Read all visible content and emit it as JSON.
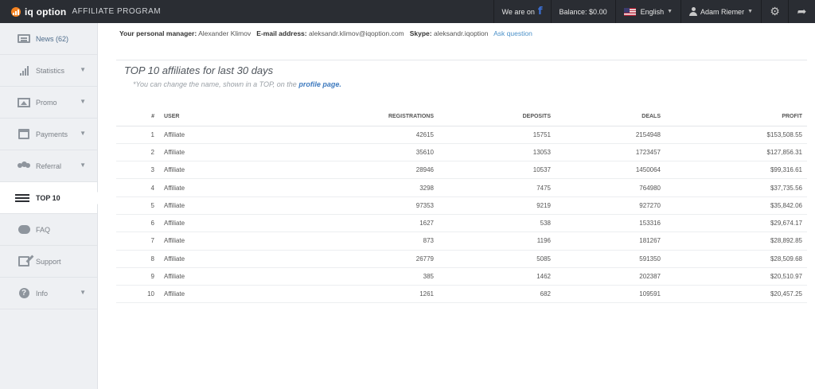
{
  "header": {
    "logo_text": "iq option",
    "logo_sub": "AFFILIATE PROGRAM",
    "we_are_on": "We are on",
    "facebook_glyph": "f",
    "balance": "Balance: $0.00",
    "language": "English",
    "user_name": "Adam Riemer",
    "settings_icon": "gear-icon",
    "share_icon": "share-icon"
  },
  "sidebar": {
    "items": [
      {
        "label": "News (62)",
        "icon": "news-icon"
      },
      {
        "label": "Statistics",
        "icon": "bar-chart-icon"
      },
      {
        "label": "Promo",
        "icon": "image-icon"
      },
      {
        "label": "Payments",
        "icon": "calendar-icon"
      },
      {
        "label": "Referral",
        "icon": "users-icon"
      },
      {
        "label": "TOP 10",
        "icon": "list-icon"
      },
      {
        "label": "FAQ",
        "icon": "chat-icon"
      },
      {
        "label": "Support",
        "icon": "edit-icon"
      },
      {
        "label": "Info",
        "icon": "help-icon"
      }
    ]
  },
  "manager": {
    "manager_label": "Your personal manager:",
    "manager_name": "Alexander Klimov",
    "email_label": "E-mail address:",
    "email_value": "aleksandr.klimov@iqoption.com",
    "skype_label": "Skype:",
    "skype_value": "aleksandr.iqoption",
    "ask_question": "Ask question"
  },
  "top": {
    "title": "TOP 10 affiliates for last 30 days",
    "note_prefix": "*You can change the name, shown in a TOP, on the",
    "note_link": "profile page."
  },
  "table": {
    "headers": {
      "num": "#",
      "user": "USER",
      "registrations": "REGISTRATIONS",
      "deposits": "DEPOSITS",
      "deals": "DEALS",
      "profit": "PROFIT"
    },
    "rows": [
      {
        "num": "1",
        "user": "Affiliate",
        "registrations": "42615",
        "deposits": "15751",
        "deals": "2154948",
        "profit": "$153,508.55"
      },
      {
        "num": "2",
        "user": "Affiliate",
        "registrations": "35610",
        "deposits": "13053",
        "deals": "1723457",
        "profit": "$127,856.31"
      },
      {
        "num": "3",
        "user": "Affiliate",
        "registrations": "28946",
        "deposits": "10537",
        "deals": "1450064",
        "profit": "$99,316.61"
      },
      {
        "num": "4",
        "user": "Affiliate",
        "registrations": "3298",
        "deposits": "7475",
        "deals": "764980",
        "profit": "$37,735.56"
      },
      {
        "num": "5",
        "user": "Affiliate",
        "registrations": "97353",
        "deposits": "9219",
        "deals": "927270",
        "profit": "$35,842.06"
      },
      {
        "num": "6",
        "user": "Affiliate",
        "registrations": "1627",
        "deposits": "538",
        "deals": "153316",
        "profit": "$29,674.17"
      },
      {
        "num": "7",
        "user": "Affiliate",
        "registrations": "873",
        "deposits": "1196",
        "deals": "181267",
        "profit": "$28,892.85"
      },
      {
        "num": "8",
        "user": "Affiliate",
        "registrations": "26779",
        "deposits": "5085",
        "deals": "591350",
        "profit": "$28,509.68"
      },
      {
        "num": "9",
        "user": "Affiliate",
        "registrations": "385",
        "deposits": "1462",
        "deals": "202387",
        "profit": "$20,510.97"
      },
      {
        "num": "10",
        "user": "Affiliate",
        "registrations": "1261",
        "deposits": "682",
        "deals": "109591",
        "profit": "$20,457.25"
      }
    ]
  },
  "colors": {
    "topbar": "#2a2d33",
    "logo_accent": "#f5821f",
    "link": "#4a90c8",
    "sidebar_bg": "#eef0f3"
  }
}
